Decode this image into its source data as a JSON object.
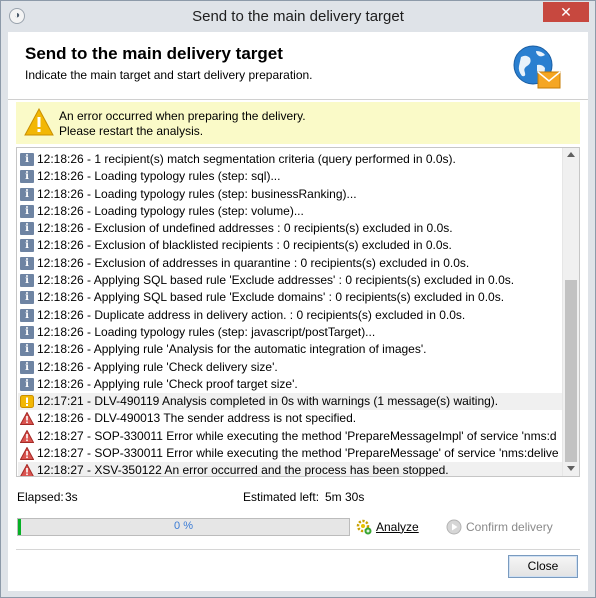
{
  "window": {
    "title": "Send to the main delivery target",
    "close_glyph": "✕"
  },
  "header": {
    "title": "Send to the main delivery target",
    "subtitle": "Indicate the main target and start delivery preparation.",
    "icon": "globe-mail-icon"
  },
  "error_banner": {
    "icon": "warning-icon",
    "line1": "An error occurred when preparing the delivery.",
    "line2": "Please restart the analysis."
  },
  "log": {
    "rows": [
      {
        "type": "info",
        "text": "12:18:26 - 1 recipient(s) match segmentation criteria (query performed in 0.0s)."
      },
      {
        "type": "info",
        "text": "12:18:26 - Loading typology rules (step: sql)..."
      },
      {
        "type": "info",
        "text": "12:18:26 - Loading typology rules (step: businessRanking)..."
      },
      {
        "type": "info",
        "text": "12:18:26 - Loading typology rules (step: volume)..."
      },
      {
        "type": "info",
        "text": "12:18:26 - Exclusion of undefined addresses : 0 recipients(s) excluded in 0.0s."
      },
      {
        "type": "info",
        "text": "12:18:26 - Exclusion of blacklisted recipients : 0 recipients(s) excluded in 0.0s."
      },
      {
        "type": "info",
        "text": "12:18:26 - Exclusion of addresses in quarantine : 0 recipients(s) excluded in 0.0s."
      },
      {
        "type": "info",
        "text": "12:18:26 - Applying SQL based rule 'Exclude addresses' : 0 recipients(s) excluded in 0.0s."
      },
      {
        "type": "info",
        "text": "12:18:26 - Applying SQL based rule 'Exclude domains' : 0 recipients(s) excluded in 0.0s."
      },
      {
        "type": "info",
        "text": "12:18:26 - Duplicate address in delivery action. : 0 recipients(s) excluded in 0.0s."
      },
      {
        "type": "info",
        "text": "12:18:26 - Loading typology rules (step: javascript/postTarget)..."
      },
      {
        "type": "info",
        "text": "12:18:26 - Applying rule 'Analysis for the automatic integration of images'."
      },
      {
        "type": "info",
        "text": "12:18:26 - Applying rule 'Check delivery size'."
      },
      {
        "type": "info",
        "text": "12:18:26 - Applying rule 'Check proof target size'."
      },
      {
        "type": "warning",
        "text": "12:17:21 - DLV-490119 Analysis completed in 0s with warnings (1 message(s) waiting)."
      },
      {
        "type": "error",
        "text": "12:18:26 - DLV-490013 The sender address is not specified."
      },
      {
        "type": "error",
        "text": "12:18:27 - SOP-330011 Error while executing the method 'PrepareMessageImpl' of service 'nms:d"
      },
      {
        "type": "error",
        "text": "12:18:27 - SOP-330011 Error while executing the method 'PrepareMessage' of service 'nms:delive"
      },
      {
        "type": "error",
        "text": "12:18:27 - XSV-350122 An error occurred and the process has been stopped."
      }
    ]
  },
  "stats": {
    "elapsed_label": "Elapsed:",
    "elapsed_value": "3s",
    "estimated_label": "Estimated left:",
    "estimated_value": "5m  30s"
  },
  "progress": {
    "label": "0 %",
    "fraction": 0.01,
    "color": "#06b025"
  },
  "buttons": {
    "analyze": "Analyze",
    "confirm": "Confirm delivery",
    "close": "Close"
  },
  "colors": {
    "banner_bg": "#fafac8",
    "title_bar": "#dfe3e8"
  }
}
